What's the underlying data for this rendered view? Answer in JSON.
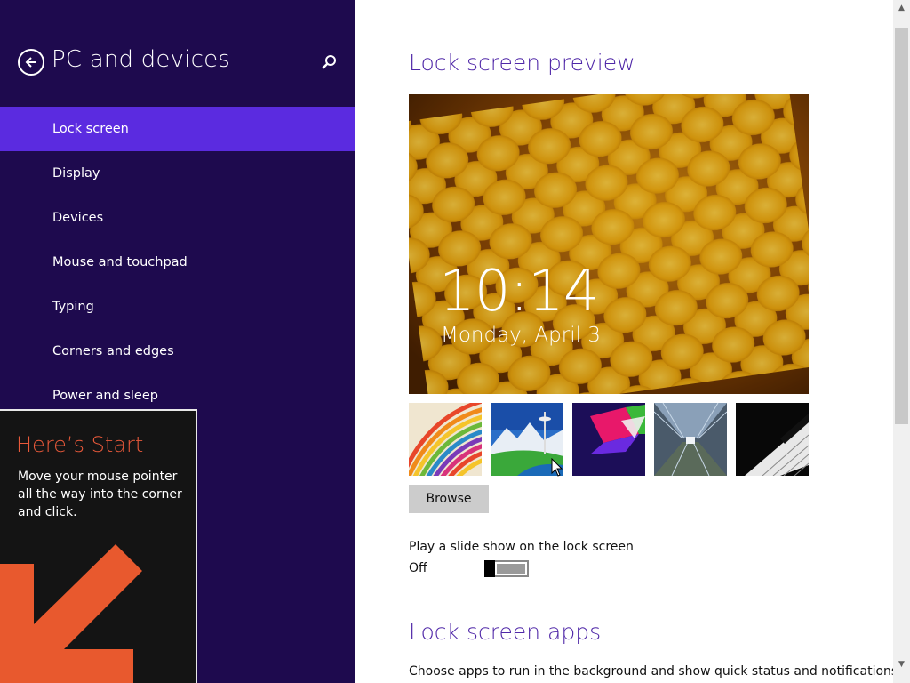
{
  "sidebar": {
    "title": "PC and devices",
    "back_icon": "back-arrow-icon",
    "search_icon": "search-icon",
    "items": [
      {
        "label": "Lock screen",
        "active": true
      },
      {
        "label": "Display"
      },
      {
        "label": "Devices"
      },
      {
        "label": "Mouse and touchpad"
      },
      {
        "label": "Typing"
      },
      {
        "label": "Corners and edges"
      },
      {
        "label": "Power and sleep"
      }
    ]
  },
  "start_tip": {
    "title": "Here’s Start",
    "text": "Move your mouse pointer all the way into the corner and click."
  },
  "main": {
    "preview_heading": "Lock screen preview",
    "preview": {
      "time": "10:14",
      "date": "Monday, April 3"
    },
    "thumbnails": [
      "rainbow-stripes-image",
      "space-needle-image",
      "abstract-shapes-image",
      "train-tunnel-image",
      "piano-keys-image"
    ],
    "browse_label": "Browse",
    "slideshow_label": "Play a slide show on the lock screen",
    "slideshow_state": "Off",
    "apps_heading": "Lock screen apps",
    "apps_description": "Choose apps to run in the background and show quick status and notifications,"
  },
  "colors": {
    "sidebar_bg": "#1e0a4e",
    "active_item": "#5b2be0",
    "heading": "#5028a8",
    "tip_title": "#e8593a"
  }
}
